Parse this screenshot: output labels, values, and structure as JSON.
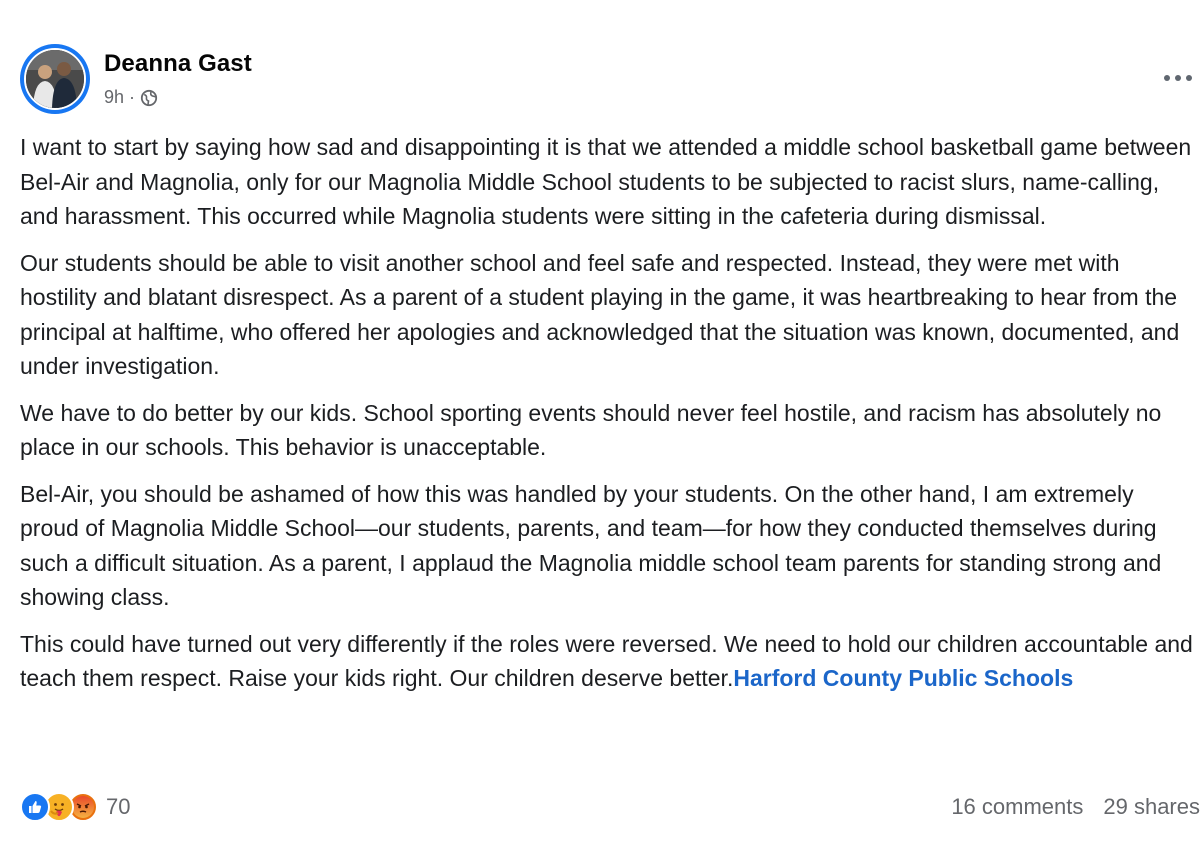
{
  "post": {
    "author": {
      "name": "Deanna Gast",
      "time": "9h",
      "separator": "·",
      "audience_icon": "globe-icon"
    },
    "more_icon": "more-options-icon",
    "paragraphs": [
      "I want to start by saying how sad and disappointing it is that we attended a middle school basketball game between Bel-Air and Magnolia, only for our Magnolia Middle School students to be subjected to racist slurs, name-calling, and harassment. This occurred while Magnolia students were sitting in the cafeteria during dismissal.",
      "Our students should be able to visit another school and feel safe and respected. Instead, they were met with hostility and blatant disrespect. As a parent of a student playing in the game, it was heartbreaking to hear from the principal at halftime, who offered her apologies and acknowledged that the situation was known, documented, and under investigation.",
      "We have to do better by our kids. School sporting events should never feel hostile, and racism has absolutely no place in our schools. This behavior is unacceptable.",
      "Bel-Air, you should be ashamed of how this was handled by your students. On the other hand, I am extremely proud of Magnolia Middle School—our students, parents, and team—for how they conducted themselves during such a difficult situation. As a parent, I applaud the Magnolia middle school team parents for standing strong and showing class."
    ],
    "last_paragraph": {
      "text": "This could have turned out very differently if the roles were reversed. We need to hold our children accountable and teach them respect. Raise your kids right. Our children deserve better.",
      "tag": "Harford County Public Schools"
    },
    "reactions": {
      "icons": [
        "like-icon",
        "care-icon",
        "angry-icon"
      ],
      "count": "70"
    },
    "comments": "16 comments",
    "shares": "29 shares",
    "colors": {
      "accent": "#1877f2",
      "link": "#1b66c9",
      "secondary_text": "#65676b"
    }
  }
}
